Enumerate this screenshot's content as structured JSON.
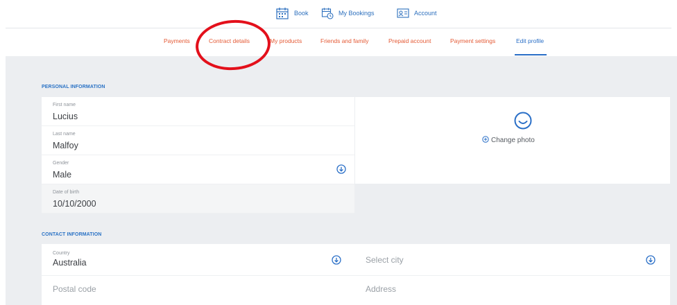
{
  "top_nav": {
    "book": "Book",
    "my_bookings": "My Bookings",
    "account": "Account"
  },
  "sub_nav": {
    "tabs": [
      "Payments",
      "Contract details",
      "My products",
      "Friends and family",
      "Prepaid account",
      "Payment settings",
      "Edit profile"
    ],
    "active_tab": "Edit profile"
  },
  "personal_information": {
    "title": "PERSONAL INFORMATION",
    "first_name": {
      "label": "First name",
      "value": "Lucius"
    },
    "last_name": {
      "label": "Last name",
      "value": "Malfoy"
    },
    "gender": {
      "label": "Gender",
      "value": "Male"
    },
    "date_of_birth": {
      "label": "Date of birth",
      "value": "10/10/2000"
    }
  },
  "photo": {
    "change_label": "Change photo"
  },
  "contact_information": {
    "title": "CONTACT INFORMATION",
    "country": {
      "label": "Country",
      "value": "Australia"
    },
    "city": {
      "placeholder": "Select city"
    },
    "postal_code": {
      "placeholder": "Postal code"
    },
    "address": {
      "placeholder": "Address"
    }
  },
  "colors": {
    "accent_blue": "#2a6fc7",
    "tab_orange": "#e45934",
    "annotation_red": "#e3101b",
    "content_bg": "#eceef1"
  },
  "icons": [
    "calendar-icon",
    "clock-calendar-icon",
    "id-card-icon",
    "chevron-down-circle-icon",
    "smiley-icon",
    "plus-circle-icon"
  ]
}
